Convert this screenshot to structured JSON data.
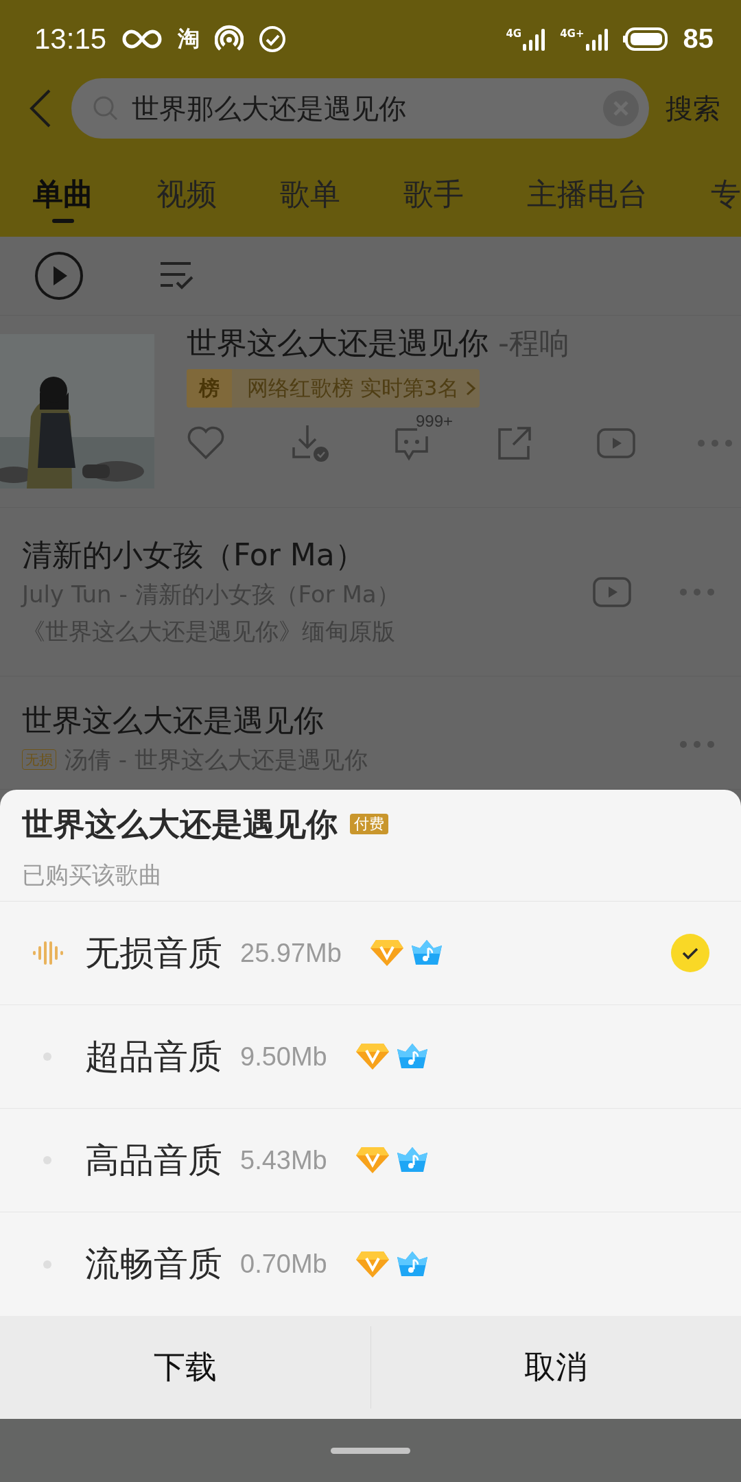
{
  "status_bar": {
    "time": "13:15",
    "app_icon_text": "淘",
    "network_1": "4G",
    "network_2": "4G+",
    "battery": "85"
  },
  "search": {
    "value": "世界那么大还是遇见你",
    "button": "搜索"
  },
  "tabs": [
    {
      "label": "单曲",
      "selected": true
    },
    {
      "label": "视频",
      "selected": false
    },
    {
      "label": "歌单",
      "selected": false
    },
    {
      "label": "歌手",
      "selected": false
    },
    {
      "label": "主播电台",
      "selected": false
    },
    {
      "label": "专",
      "selected": false
    }
  ],
  "songs": [
    {
      "kind": "featured",
      "title": "世界这么大还是遇见你",
      "artist": "-程响",
      "chart_icon": "榜",
      "chart": "网络红歌榜 实时第3名",
      "comments": "999+"
    },
    {
      "kind": "plain",
      "title": "清新的小女孩（For Ma）",
      "lines": [
        "July Tun - 清新的小女孩（For Ma）",
        "《世界这么大还是遇见你》缅甸原版"
      ],
      "has_video": true
    },
    {
      "kind": "plain",
      "title": "世界这么大还是遇见你",
      "badge": "无损",
      "lines": [
        "汤倩 - 世界这么大还是遇见你"
      ],
      "has_video": false
    }
  ],
  "sheet": {
    "title": "世界这么大还是遇见你",
    "badge": "付费",
    "subtitle": "已购买该歌曲",
    "options": [
      {
        "label": "无损音质",
        "size": "25.97Mb",
        "selected": true
      },
      {
        "label": "超品音质",
        "size": "9.50Mb",
        "selected": false
      },
      {
        "label": "高品音质",
        "size": "5.43Mb",
        "selected": false
      },
      {
        "label": "流畅音质",
        "size": "0.70Mb",
        "selected": false
      }
    ],
    "buttons": [
      "下载",
      "取消"
    ]
  }
}
